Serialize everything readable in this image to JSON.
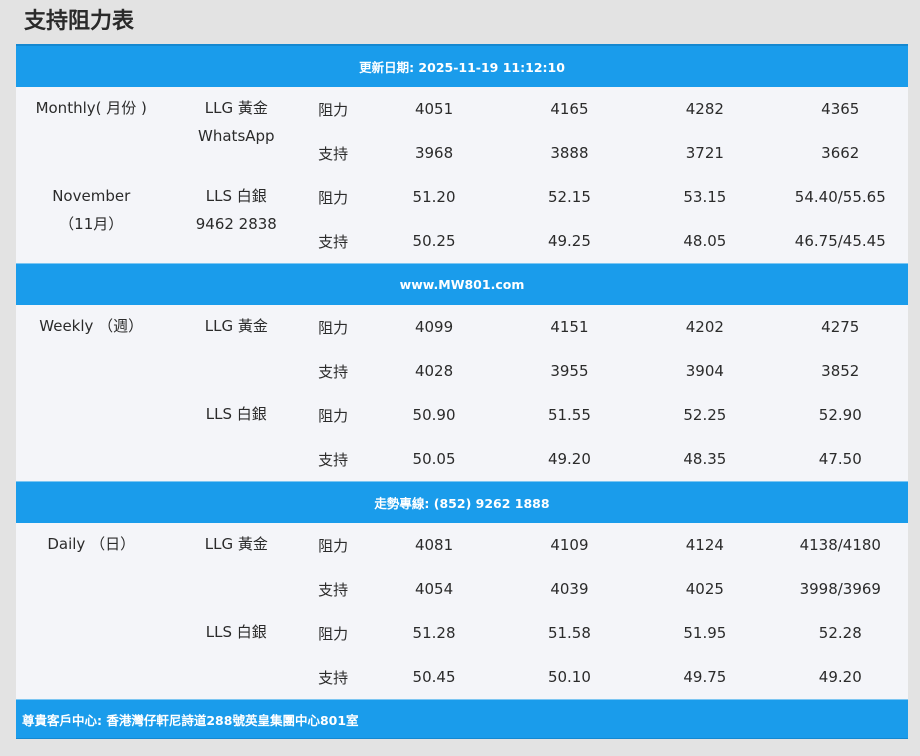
{
  "title": "支持阻力表",
  "banners": {
    "update": "更新日期: 2025-11-19 11:12:10",
    "website": "www.MW801.com",
    "hotline": "走勢專線: (852) 9262 1888",
    "address": "尊貴客戶中心: 香港灣仔軒尼詩道288號英皇集團中心801室"
  },
  "labels": {
    "resistance": "阻力",
    "support": "支持"
  },
  "monthly": {
    "period_line1": "Monthly( 月份 )",
    "period_line2": "November",
    "period_line3": "（11月）",
    "llg_name": "LLG 黃金",
    "llg_extra": "WhatsApp",
    "lls_name": "LLS 白銀",
    "lls_extra": "9462 2838",
    "llg_resistance": [
      "4051",
      "4165",
      "4282",
      "4365"
    ],
    "llg_support": [
      "3968",
      "3888",
      "3721",
      "3662"
    ],
    "lls_resistance": [
      "51.20",
      "52.15",
      "53.15",
      "54.40/55.65"
    ],
    "lls_support": [
      "50.25",
      "49.25",
      "48.05",
      "46.75/45.45"
    ]
  },
  "weekly": {
    "period": "Weekly （週）",
    "llg_name": "LLG 黃金",
    "lls_name": "LLS 白銀",
    "llg_resistance": [
      "4099",
      "4151",
      "4202",
      "4275"
    ],
    "llg_support": [
      "4028",
      "3955",
      "3904",
      "3852"
    ],
    "lls_resistance": [
      "50.90",
      "51.55",
      "52.25",
      "52.90"
    ],
    "lls_support": [
      "50.05",
      "49.20",
      "48.35",
      "47.50"
    ]
  },
  "daily": {
    "period": "Daily （日）",
    "llg_name": "LLG 黃金",
    "lls_name": "LLS 白銀",
    "llg_resistance": [
      "4081",
      "4109",
      "4124",
      "4138/4180"
    ],
    "llg_support": [
      "4054",
      "4039",
      "4025",
      "3998/3969"
    ],
    "lls_resistance": [
      "51.28",
      "51.58",
      "51.95",
      "52.28"
    ],
    "lls_support": [
      "50.45",
      "50.10",
      "49.75",
      "49.20"
    ]
  }
}
